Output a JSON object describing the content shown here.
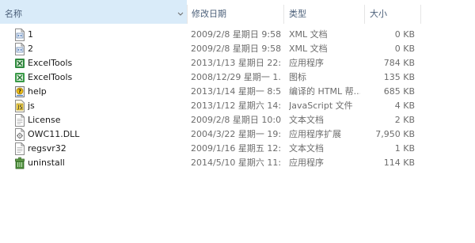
{
  "columns": {
    "name": "名称",
    "date": "修改日期",
    "type": "类型",
    "size": "大小"
  },
  "files": [
    {
      "icon": "xml-document-icon",
      "name": "1",
      "date": "2009/2/8 星期日 9:58",
      "type": "XML 文档",
      "size": "0 KB"
    },
    {
      "icon": "xml-document-icon",
      "name": "2",
      "date": "2009/2/8 星期日 9:58",
      "type": "XML 文档",
      "size": "0 KB"
    },
    {
      "icon": "excel-app-icon",
      "name": "ExcelTools",
      "date": "2013/1/13 星期日 22:...",
      "type": "应用程序",
      "size": "784 KB"
    },
    {
      "icon": "excel-icon-file-icon",
      "name": "ExcelTools",
      "date": "2008/12/29 星期一 1...",
      "type": "图标",
      "size": "135 KB"
    },
    {
      "icon": "help-file-icon",
      "name": "help",
      "date": "2013/1/14 星期一 8:55",
      "type": "编译的 HTML 帮...",
      "size": "685 KB"
    },
    {
      "icon": "javascript-file-icon",
      "name": "js",
      "date": "2013/1/12 星期六 14:...",
      "type": "JavaScript 文件",
      "size": "4 KB"
    },
    {
      "icon": "text-file-icon",
      "name": "License",
      "date": "2009/2/8 星期日 10:05",
      "type": "文本文档",
      "size": "2 KB"
    },
    {
      "icon": "dll-file-icon",
      "name": "OWC11.DLL",
      "date": "2004/3/22 星期一 19:...",
      "type": "应用程序扩展",
      "size": "7,950 KB"
    },
    {
      "icon": "text-file-icon",
      "name": "regsvr32",
      "date": "2009/1/16 星期五 12:...",
      "type": "文本文档",
      "size": "1 KB"
    },
    {
      "icon": "uninstall-app-icon",
      "name": "uninstall",
      "date": "2014/5/10 星期六 11:...",
      "type": "应用程序",
      "size": "114 KB"
    }
  ]
}
